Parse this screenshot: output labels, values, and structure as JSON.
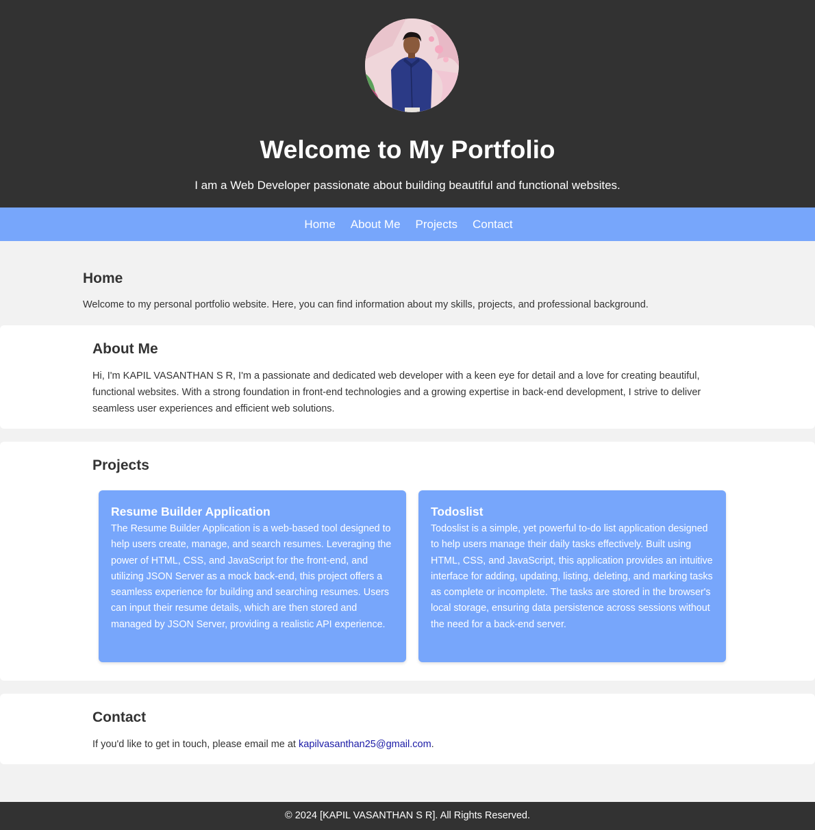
{
  "header": {
    "title": "Welcome to My Portfolio",
    "subtitle": "I am a Web Developer passionate about building beautiful and functional websites."
  },
  "nav": {
    "items": [
      {
        "label": "Home"
      },
      {
        "label": "About Me"
      },
      {
        "label": "Projects"
      },
      {
        "label": "Contact"
      }
    ]
  },
  "home": {
    "title": "Home",
    "text": "Welcome to my personal portfolio website. Here, you can find information about my skills, projects, and professional background."
  },
  "about": {
    "title": "About Me",
    "text": "Hi, I'm KAPIL VASANTHAN S R, I'm a passionate and dedicated web developer with a keen eye for detail and a love for creating beautiful, functional websites. With a strong foundation in front-end technologies and a growing expertise in back-end development, I strive to deliver seamless user experiences and efficient web solutions."
  },
  "projects": {
    "title": "Projects",
    "items": [
      {
        "title": "Resume Builder Application",
        "description": "The Resume Builder Application is a web-based tool designed to help users create, manage, and search resumes. Leveraging the power of HTML, CSS, and JavaScript for the front-end, and utilizing JSON Server as a mock back-end, this project offers a seamless experience for building and searching resumes. Users can input their resume details, which are then stored and managed by JSON Server, providing a realistic API experience."
      },
      {
        "title": "Todoslist",
        "description": "Todoslist is a simple, yet powerful to-do list application designed to help users manage their daily tasks effectively. Built using HTML, CSS, and JavaScript, this application provides an intuitive interface for adding, updating, listing, deleting, and marking tasks as complete or incomplete. The tasks are stored in the browser's local storage, ensuring data persistence across sessions without the need for a back-end server."
      }
    ]
  },
  "contact": {
    "title": "Contact",
    "text_before": "If you'd like to get in touch, please email me at ",
    "email": "kapilvasanthan25@gmail.com",
    "text_after": "."
  },
  "footer": {
    "text": "© 2024 [KAPIL VASANTHAN S R]. All Rights Reserved."
  },
  "colors": {
    "header_bg": "#323232",
    "accent": "#77a6fb",
    "page_bg": "#f2f2f2",
    "link": "#1a1aa6"
  }
}
